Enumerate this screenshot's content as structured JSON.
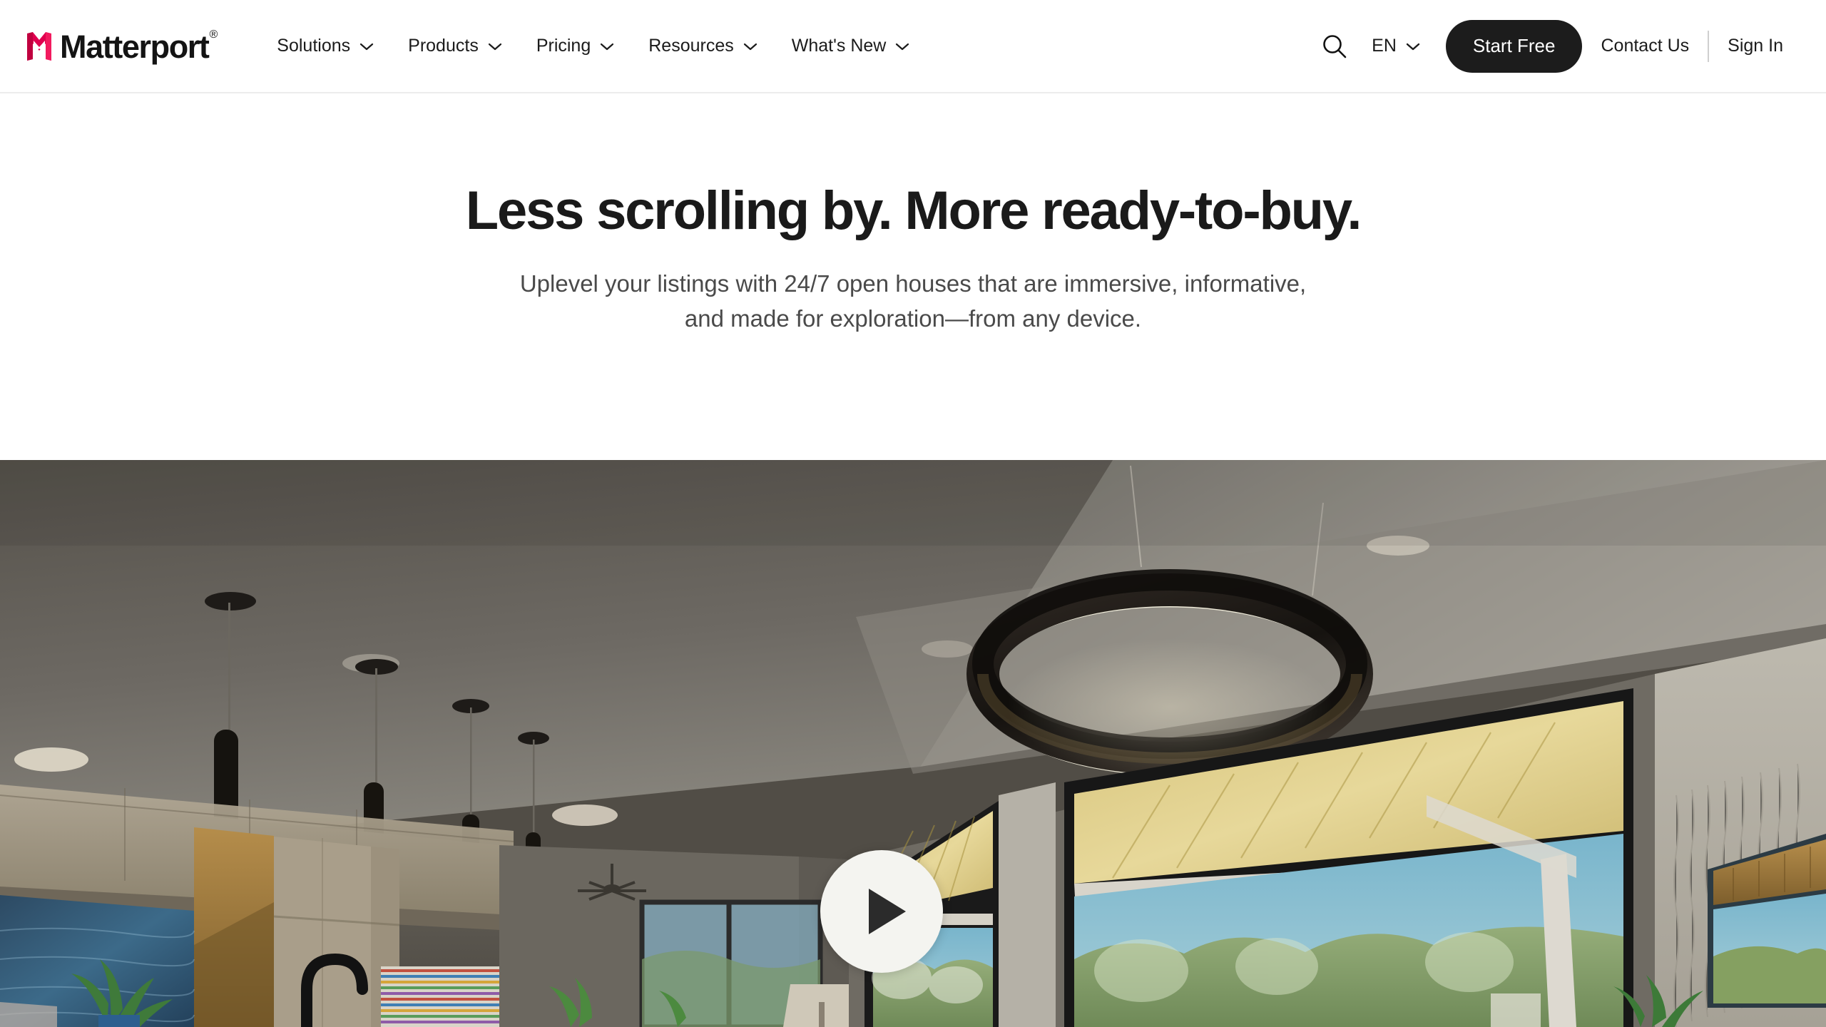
{
  "brand": {
    "name": "Matterport",
    "registered_mark": "®",
    "logo_icon": "matterport-m-logo",
    "logo_color": "#e0004f"
  },
  "nav": {
    "items": [
      {
        "label": "Solutions",
        "icon": "chevron-down-icon"
      },
      {
        "label": "Products",
        "icon": "chevron-down-icon"
      },
      {
        "label": "Pricing",
        "icon": "chevron-down-icon"
      },
      {
        "label": "Resources",
        "icon": "chevron-down-icon"
      },
      {
        "label": "What's New",
        "icon": "chevron-down-icon"
      }
    ],
    "search_icon": "search-icon",
    "language": {
      "label": "EN",
      "icon": "chevron-down-icon"
    },
    "cta_label": "Start Free",
    "contact_label": "Contact Us",
    "signin_label": "Sign In",
    "cta_bg": "#1c1c1c",
    "cta_text_color": "#ffffff"
  },
  "hero": {
    "title": "Less scrolling by. More ready-to-buy.",
    "subtitle_line1": "Uplevel your listings with 24/7 open houses that are immersive, informative,",
    "subtitle_line2": "and made for exploration—from any device.",
    "title_color": "#1a1a1a",
    "subtitle_color": "#4a4a4a"
  },
  "media": {
    "play_icon": "play-icon",
    "play_button_bg": "#f4f4f0",
    "play_triangle_color": "#2b2b2b",
    "alt": "Modern open-plan living room interior with circular pendant light and floor-to-ceiling windows"
  }
}
